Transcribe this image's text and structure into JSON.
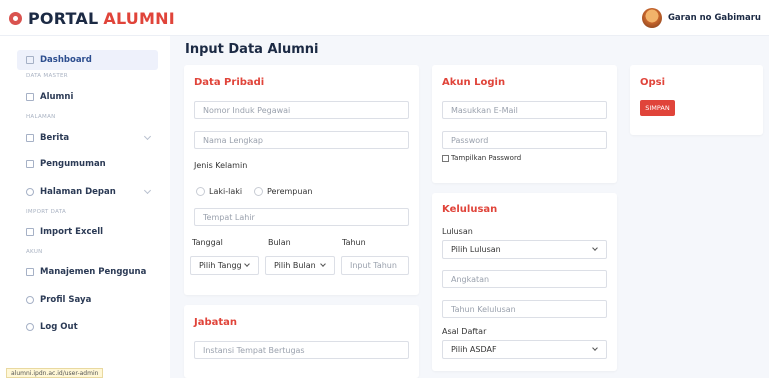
{
  "header": {
    "logo_portal": "PORTAL",
    "logo_alumni": "ALUMNI",
    "username": "Garan no Gabimaru"
  },
  "sidebar": {
    "dashboard": "Dashboard",
    "section_data_master": "DATA MASTER",
    "alumni": "Alumni",
    "section_halaman": "HALAMAN",
    "berita": "Berita",
    "pengumuman": "Pengumuman",
    "halaman_depan": "Halaman Depan",
    "section_import": "IMPORT DATA",
    "import_excell": "Import Excell",
    "section_akun": "AKUN",
    "manajemen_pengguna": "Manajemen Pengguna",
    "profil_saya": "Profil Saya",
    "log_out": "Log Out"
  },
  "page": {
    "title": "Input Data Alumni"
  },
  "data_pribadi": {
    "title": "Data Pribadi",
    "nip_placeholder": "Nomor Induk Pegawai",
    "nama_placeholder": "Nama Lengkap",
    "jenis_kelamin_label": "Jenis Kelamin",
    "laki_laki": "Laki-laki",
    "perempuan": "Perempuan",
    "tempat_lahir_placeholder": "Tempat Lahir",
    "tanggal_label": "Tanggal",
    "bulan_label": "Bulan",
    "tahun_label": "Tahun",
    "tanggal_select": "Pilih Tangg",
    "bulan_select": "Pilih Bulan",
    "tahun_placeholder": "Input Tahun"
  },
  "jabatan": {
    "title": "Jabatan",
    "instansi_placeholder": "Instansi Tempat Bertugas"
  },
  "akun_login": {
    "title": "Akun Login",
    "email_placeholder": "Masukkan E-Mail",
    "password_placeholder": "Password",
    "show_password": "Tampilkan Password"
  },
  "kelulusan": {
    "title": "Kelulusan",
    "lulusan_label": "Lulusan",
    "lulusan_select": "Pilih Lulusan",
    "angkatan_placeholder": "Angkatan",
    "tahun_kelulusan_placeholder": "Tahun Kelulusan",
    "asal_daftar_label": "Asal Daftar",
    "asal_daftar_select": "Pilih ASDAF"
  },
  "opsi": {
    "title": "Opsi",
    "simpan": "SIMPAN"
  },
  "status": {
    "url": "alumni.ipdn.ac.id/user-admin"
  },
  "colors": {
    "accent": "#e0443a",
    "navy": "#1c2a44",
    "background": "#f5f7fb"
  }
}
